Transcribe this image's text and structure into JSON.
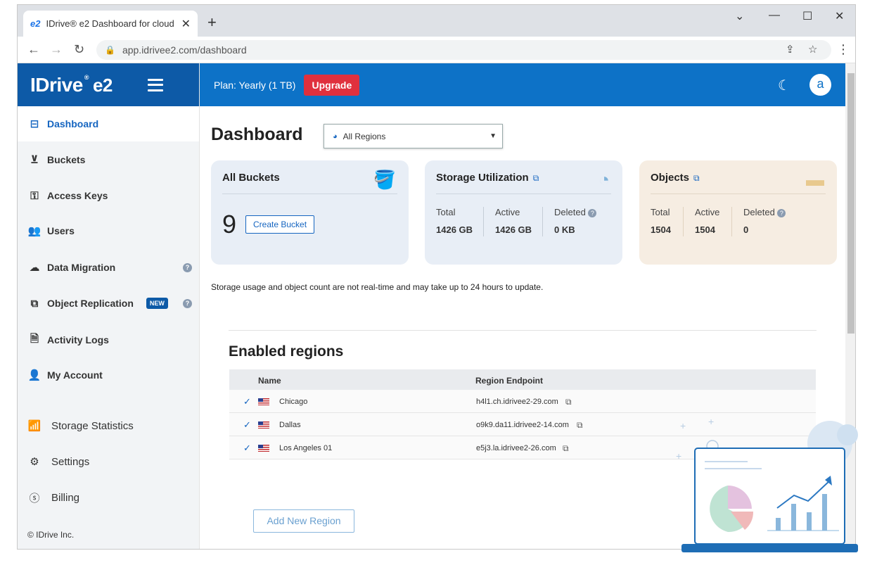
{
  "browser": {
    "tab_title": "IDrive® e2 Dashboard for cloud",
    "tab_favicon": "e2",
    "url": "app.idrivee2.com/dashboard"
  },
  "brand": {
    "name": "IDrive",
    "reg": "®",
    "product": "e2"
  },
  "topbar": {
    "plan": "Plan: Yearly (1 TB)",
    "upgrade": "Upgrade",
    "avatar": "a"
  },
  "sidebar": {
    "items": [
      {
        "label": "Dashboard",
        "icon": "layout-icon"
      },
      {
        "label": "Buckets",
        "icon": "bucket-icon"
      },
      {
        "label": "Access Keys",
        "icon": "key-icon"
      },
      {
        "label": "Users",
        "icon": "users-icon"
      },
      {
        "label": "Data Migration",
        "icon": "cloud-icon"
      },
      {
        "label": "Object Replication",
        "icon": "replication-icon",
        "badge": "NEW"
      },
      {
        "label": "Activity Logs",
        "icon": "document-icon"
      },
      {
        "label": "My Account",
        "icon": "person-icon"
      },
      {
        "label": "Storage Statistics",
        "icon": "bar-chart-icon"
      },
      {
        "label": "Settings",
        "icon": "gear-icon"
      },
      {
        "label": "Billing",
        "icon": "dollar-icon"
      }
    ],
    "copyright": "© IDrive Inc."
  },
  "main": {
    "title": "Dashboard",
    "region_select": "All Regions",
    "cards": {
      "buckets": {
        "title": "All Buckets",
        "count": "9",
        "button": "Create Bucket"
      },
      "storage": {
        "title": "Storage Utilization",
        "labels": [
          "Total",
          "Active",
          "Deleted"
        ],
        "values": [
          "1426 GB",
          "1426 GB",
          "0 KB"
        ]
      },
      "objects": {
        "title": "Objects",
        "labels": [
          "Total",
          "Active",
          "Deleted"
        ],
        "values": [
          "1504",
          "1504",
          "0"
        ]
      }
    },
    "note": "Storage usage and object count are not real-time and may take up to 24 hours to update.",
    "regions": {
      "title": "Enabled regions",
      "headers": [
        "Name",
        "Region Endpoint"
      ],
      "rows": [
        {
          "name": "Chicago",
          "endpoint": "h4l1.ch.idrivee2-29.com"
        },
        {
          "name": "Dallas",
          "endpoint": "o9k9.da11.idrivee2-14.com"
        },
        {
          "name": "Los Angeles 01",
          "endpoint": "e5j3.la.idrivee2-26.com"
        }
      ],
      "add_button": "Add New Region"
    }
  },
  "colors": {
    "brand": "#0d5aa7",
    "topbar": "#0d72c7",
    "upgrade": "#e0303d",
    "card_blue": "#e8eef6",
    "card_objects": "#f6ede2"
  }
}
